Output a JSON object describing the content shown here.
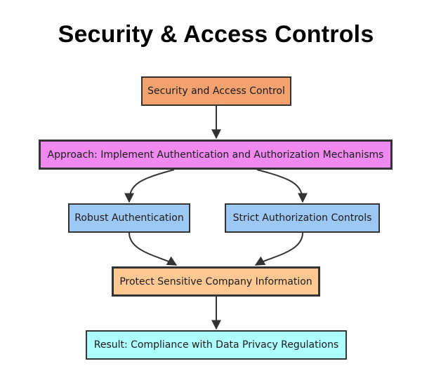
{
  "title": "Security & Access Controls",
  "nodes": {
    "security": "Security and Access Control",
    "approach": "Approach: Implement Authentication and Authorization Mechanisms",
    "authn": "Robust Authentication",
    "authz": "Strict Authorization Controls",
    "protect": "Protect Sensitive Company Information",
    "result": "Result: Compliance with Data Privacy Regulations"
  },
  "edges": [
    {
      "from": "security",
      "to": "approach"
    },
    {
      "from": "approach",
      "to": "authn"
    },
    {
      "from": "approach",
      "to": "authz"
    },
    {
      "from": "authn",
      "to": "protect"
    },
    {
      "from": "authz",
      "to": "protect"
    },
    {
      "from": "protect",
      "to": "result"
    }
  ],
  "colors": {
    "security": "#f4a170",
    "approach": "#ef88ef",
    "authentication": "#9ec8f4",
    "protect": "#fec893",
    "result": "#aefdfd",
    "edge": "#333333"
  }
}
